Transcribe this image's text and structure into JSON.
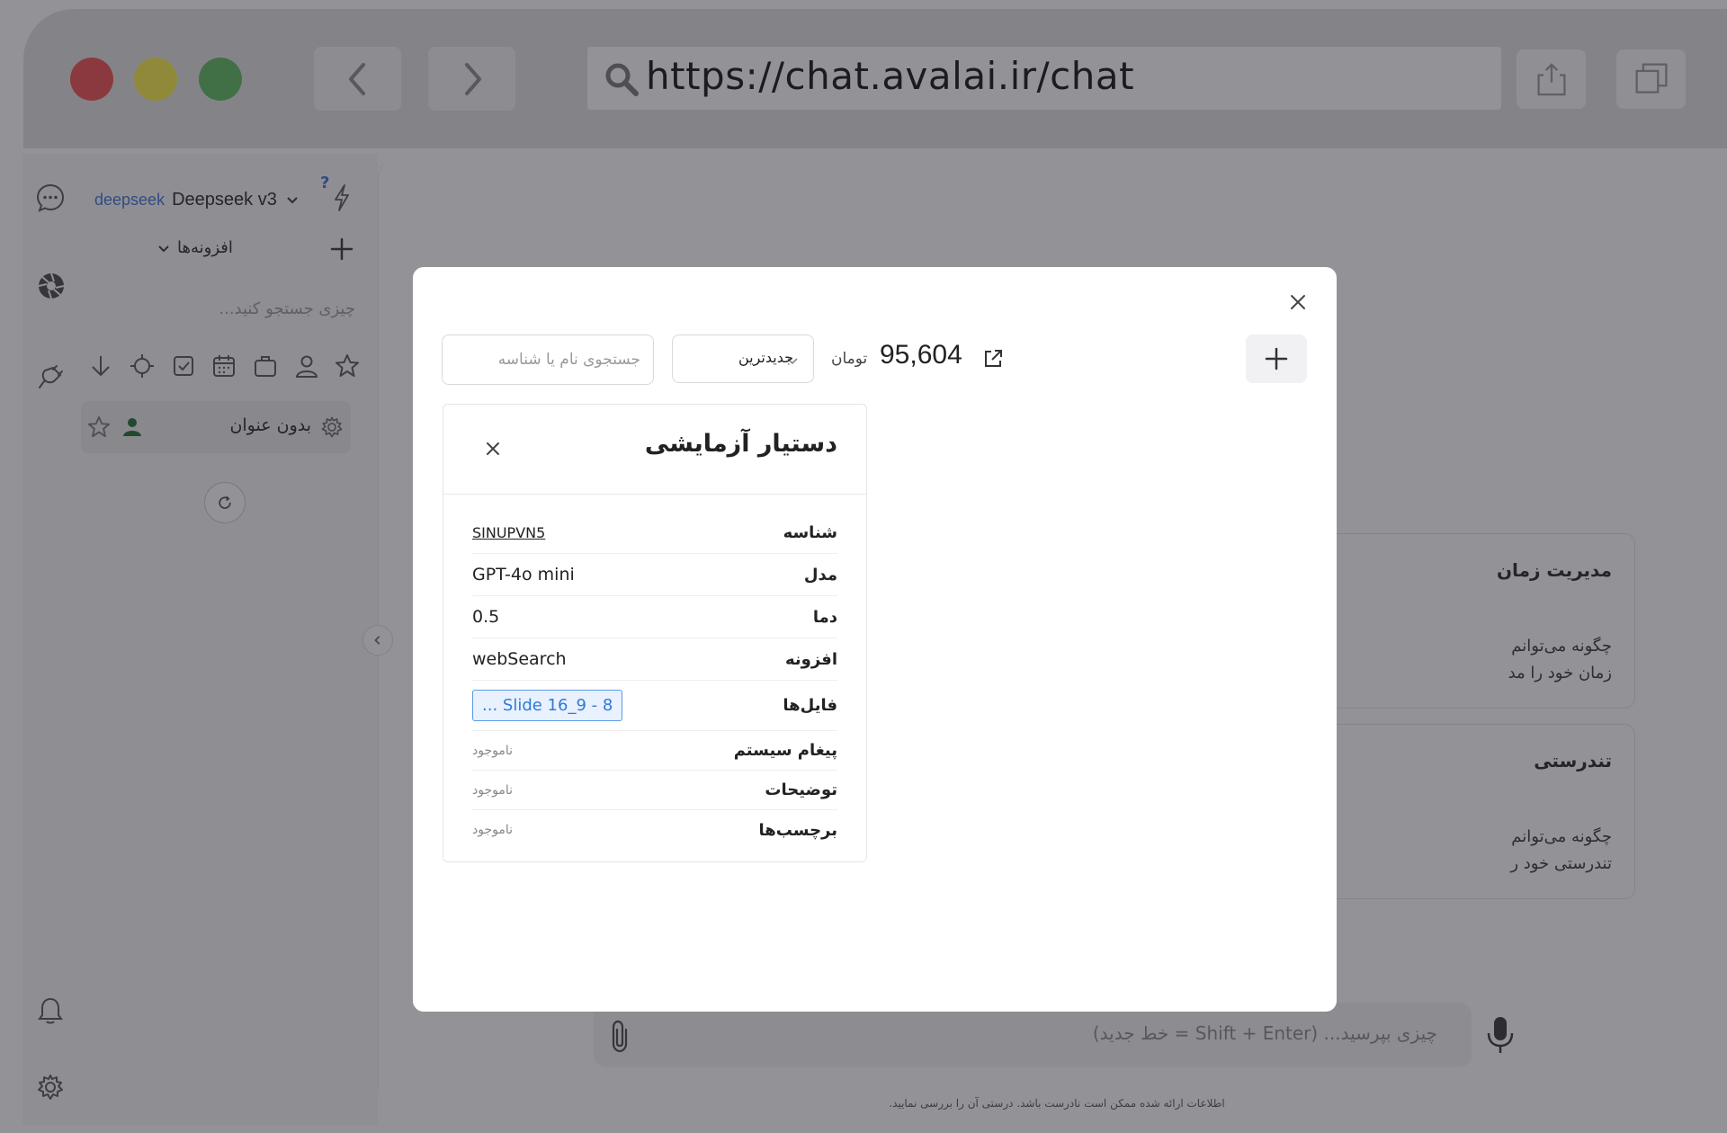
{
  "browser": {
    "url": "https://chat.avalai.ir/chat"
  },
  "sidebar": {
    "model_brand": "deepseek",
    "model_name": "Deepseek v3",
    "help_mark": "?",
    "plugins_label": "افزونه‌ها",
    "search_placeholder": "چیزی جستجو کنید...",
    "chats": [
      {
        "title": "بدون عنوان"
      }
    ]
  },
  "main": {
    "cards": [
      {
        "title": "مدیریت زمان",
        "desc_line1": "چگونه می‌توانم",
        "desc_line2": "زمان خود را مد"
      },
      {
        "title": "تندرستی",
        "desc_line1": "چگونه می‌توانم",
        "desc_line2": "تندرستی خود ر"
      }
    ],
    "input_placeholder": "چیزی بپرسید... (Shift + Enter = خط جدید)",
    "disclaimer": "اطلاعات ارائه شده ممکن است نادرست باشد. درستی آن را بررسی نمایید."
  },
  "modal": {
    "search_placeholder": "جستجوی نام یا شناسه",
    "sort_value": "جدیدترین",
    "currency": "تومان",
    "balance": "95,604",
    "assistant": {
      "title": "دستیار آزمایشی",
      "fields": {
        "id_label": "شناسه",
        "id_value": "SINUPVN5",
        "model_label": "مدل",
        "model_value": "GPT-4o mini",
        "temp_label": "دما",
        "temp_value": "0.5",
        "plugin_label": "افزونه",
        "plugin_value": "webSearch",
        "files_label": "فایل‌ها",
        "files_value": "8 - Slide 16_9 ...",
        "system_label": "پیغام سیستم",
        "system_value": "ناموجود",
        "desc_label": "توضیحات",
        "desc_value": "ناموجود",
        "tags_label": "برچسب‌ها",
        "tags_value": "ناموجود"
      }
    }
  },
  "colors": {
    "traffic_red": "#ec4c4c",
    "traffic_yellow": "#f9ea45",
    "traffic_green": "#5cb85c",
    "brand_blue": "#3b6fd8",
    "file_chip_bg": "#e8f1fd",
    "file_chip_border": "#5b9be6"
  }
}
